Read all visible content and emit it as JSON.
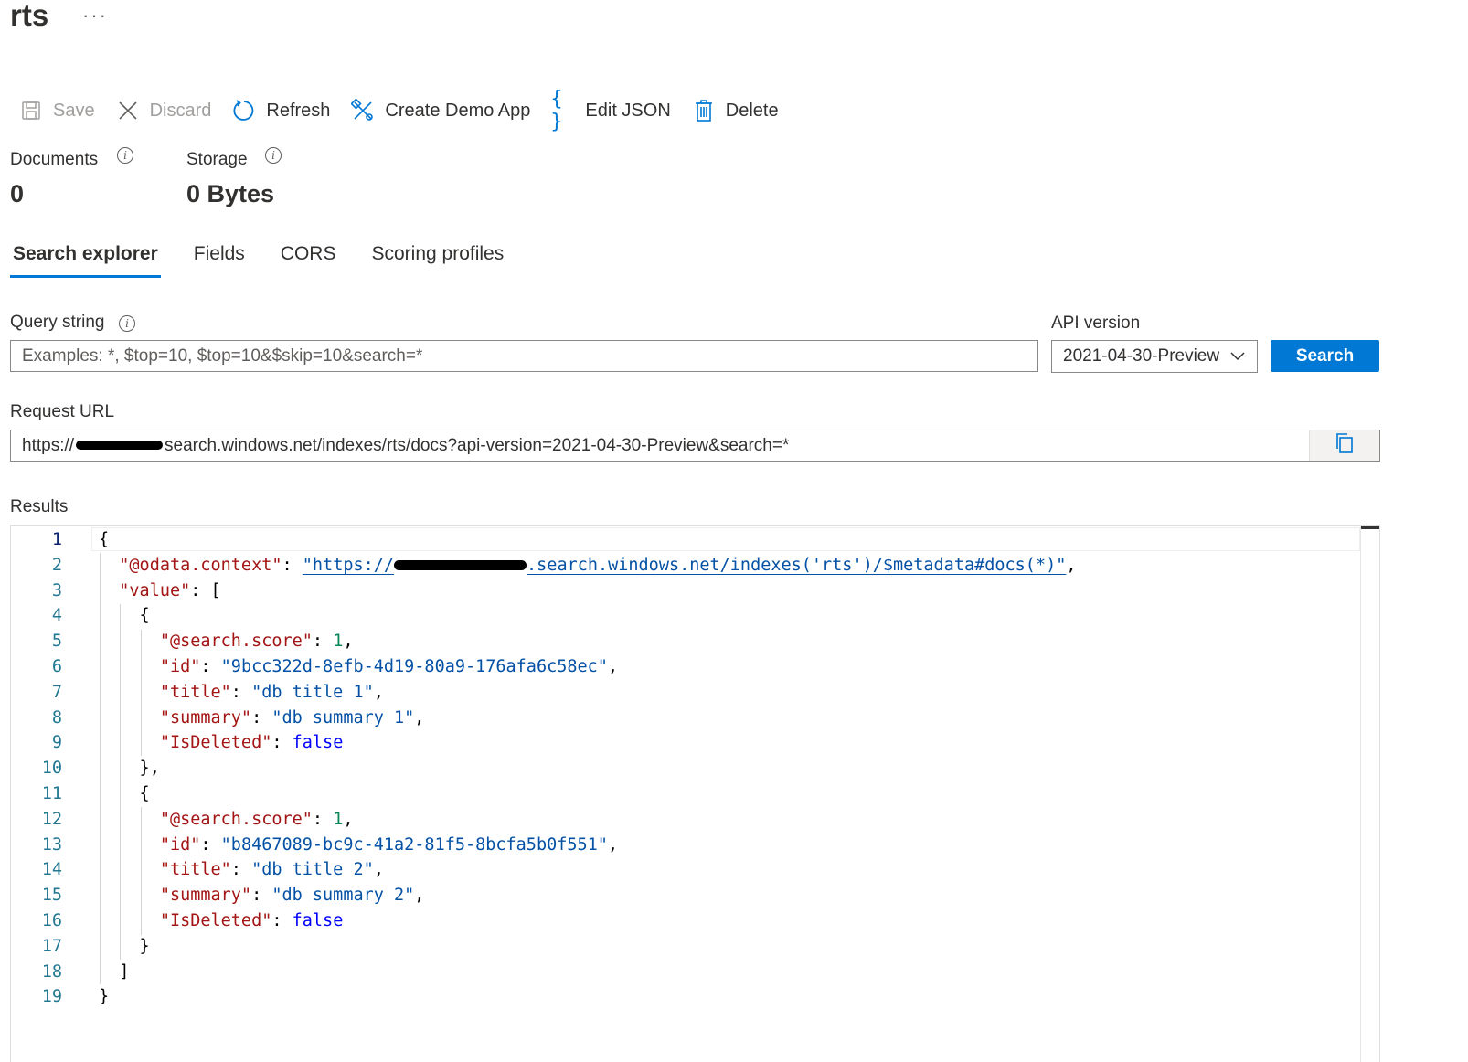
{
  "header": {
    "title": "rts",
    "more_label": "···"
  },
  "toolbar": {
    "save": "Save",
    "discard": "Discard",
    "refresh": "Refresh",
    "create_demo_app": "Create Demo App",
    "edit_json": "Edit JSON",
    "delete": "Delete"
  },
  "stats": {
    "documents_label": "Documents",
    "documents_value": "0",
    "storage_label": "Storage",
    "storage_value": "0 Bytes",
    "info_glyph": "i"
  },
  "tabs": [
    "Search explorer",
    "Fields",
    "CORS",
    "Scoring profiles"
  ],
  "query": {
    "label": "Query string",
    "placeholder": "Examples:  *, $top=10, $top=10&$skip=10&search=*",
    "value": ""
  },
  "api_version": {
    "label": "API version",
    "selected": "2021-04-30-Preview"
  },
  "search_button": "Search",
  "request_url": {
    "label": "Request URL",
    "prefix": "https://",
    "suffix": "search.windows.net/indexes/rts/docs?api-version=2021-04-30-Preview&search=*"
  },
  "results": {
    "label": "Results",
    "line_numbers": [
      "1",
      "2",
      "3",
      "4",
      "5",
      "6",
      "7",
      "8",
      "9",
      "10",
      "11",
      "12",
      "13",
      "14",
      "15",
      "16",
      "17",
      "18",
      "19"
    ],
    "odata_context_key": "\"@odata.context\"",
    "odata_context_prefix": "\"https://",
    "odata_context_suffix": ".search.windows.net/indexes('rts')/$metadata#docs(*)\"",
    "value_key": "\"value\"",
    "documents": [
      {
        "score": "1",
        "id": "\"9bcc322d-8efb-4d19-80a9-176afa6c58ec\"",
        "title": "\"db title 1\"",
        "summary": "\"db summary 1\"",
        "is_deleted": "false"
      },
      {
        "score": "1",
        "id": "\"b8467089-bc9c-41a2-81f5-8bcfa5b0f551\"",
        "title": "\"db title 2\"",
        "summary": "\"db summary 2\"",
        "is_deleted": "false"
      }
    ],
    "keys": {
      "score": "\"@search.score\"",
      "id": "\"id\"",
      "title": "\"title\"",
      "summary": "\"summary\"",
      "is_deleted": "\"IsDeleted\""
    }
  },
  "colors": {
    "accent": "#0078d4",
    "json_key": "#a31515",
    "json_string": "#0451a5",
    "json_number": "#098658",
    "json_boolean": "#0000ff",
    "line_number": "#237893"
  },
  "icons": {
    "save": "save-icon",
    "discard": "close-icon",
    "refresh": "refresh-icon",
    "create_demo_app": "demo-app-icon",
    "edit_json": "braces-icon",
    "delete": "trash-icon",
    "copy": "copy-icon",
    "dropdown": "chevron-down-icon"
  }
}
